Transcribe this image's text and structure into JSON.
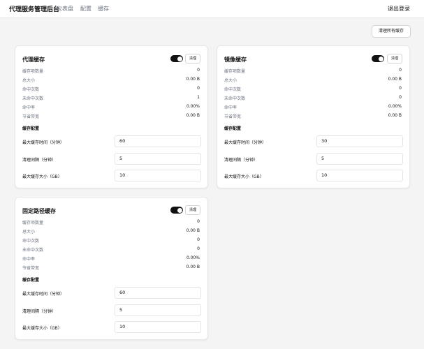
{
  "nav": {
    "brand": "代理服务管理后台",
    "links": [
      "仪表盘",
      "配置",
      "缓存"
    ],
    "logout": "退出登录"
  },
  "toolbar": {
    "clear_all": "清理所有缓存"
  },
  "cards": [
    {
      "title": "代理缓存",
      "enabled": true,
      "clear_label": "清理",
      "stats": [
        {
          "label": "缓存项数量",
          "value": "0"
        },
        {
          "label": "总大小",
          "value": "0.00 B"
        },
        {
          "label": "命中次数",
          "value": "0"
        },
        {
          "label": "未命中次数",
          "value": "1"
        },
        {
          "label": "命中率",
          "value": "0.00%"
        },
        {
          "label": "节省带宽",
          "value": "0.00 B"
        }
      ],
      "config_title": "缓存配置",
      "config": [
        {
          "label": "最大缓存时间（分钟）",
          "value": "60"
        },
        {
          "label": "清理间隔（分钟）",
          "value": "5"
        },
        {
          "label": "最大缓存大小（GB）",
          "value": "10"
        }
      ]
    },
    {
      "title": "镜像缓存",
      "enabled": true,
      "clear_label": "清理",
      "stats": [
        {
          "label": "缓存项数量",
          "value": "0"
        },
        {
          "label": "总大小",
          "value": "0.00 B"
        },
        {
          "label": "命中次数",
          "value": "0"
        },
        {
          "label": "未命中次数",
          "value": "0"
        },
        {
          "label": "命中率",
          "value": "0.00%"
        },
        {
          "label": "节省带宽",
          "value": "0.00 B"
        }
      ],
      "config_title": "缓存配置",
      "config": [
        {
          "label": "最大缓存时间（分钟）",
          "value": "30"
        },
        {
          "label": "清理间隔（分钟）",
          "value": "5"
        },
        {
          "label": "最大缓存大小（GB）",
          "value": "10"
        }
      ]
    },
    {
      "title": "固定路径缓存",
      "enabled": true,
      "clear_label": "清理",
      "stats": [
        {
          "label": "缓存项数量",
          "value": "0"
        },
        {
          "label": "总大小",
          "value": "0.00 B"
        },
        {
          "label": "命中次数",
          "value": "0"
        },
        {
          "label": "未命中次数",
          "value": "0"
        },
        {
          "label": "命中率",
          "value": "0.00%"
        },
        {
          "label": "节省带宽",
          "value": "0.00 B"
        }
      ],
      "config_title": "缓存配置",
      "config": [
        {
          "label": "最大缓存时间（分钟）",
          "value": "60"
        },
        {
          "label": "清理间隔（分钟）",
          "value": "5"
        },
        {
          "label": "最大缓存大小（GB）",
          "value": "10"
        }
      ]
    }
  ]
}
